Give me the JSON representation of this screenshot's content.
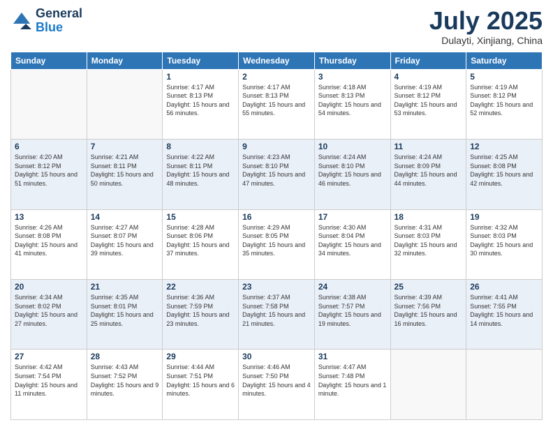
{
  "logo": {
    "general": "General",
    "blue": "Blue"
  },
  "header": {
    "month": "July 2025",
    "location": "Dulayti, Xinjiang, China"
  },
  "weekdays": [
    "Sunday",
    "Monday",
    "Tuesday",
    "Wednesday",
    "Thursday",
    "Friday",
    "Saturday"
  ],
  "weeks": [
    [
      {
        "day": "",
        "info": ""
      },
      {
        "day": "",
        "info": ""
      },
      {
        "day": "1",
        "info": "Sunrise: 4:17 AM\nSunset: 8:13 PM\nDaylight: 15 hours and 56 minutes."
      },
      {
        "day": "2",
        "info": "Sunrise: 4:17 AM\nSunset: 8:13 PM\nDaylight: 15 hours and 55 minutes."
      },
      {
        "day": "3",
        "info": "Sunrise: 4:18 AM\nSunset: 8:13 PM\nDaylight: 15 hours and 54 minutes."
      },
      {
        "day": "4",
        "info": "Sunrise: 4:19 AM\nSunset: 8:12 PM\nDaylight: 15 hours and 53 minutes."
      },
      {
        "day": "5",
        "info": "Sunrise: 4:19 AM\nSunset: 8:12 PM\nDaylight: 15 hours and 52 minutes."
      }
    ],
    [
      {
        "day": "6",
        "info": "Sunrise: 4:20 AM\nSunset: 8:12 PM\nDaylight: 15 hours and 51 minutes."
      },
      {
        "day": "7",
        "info": "Sunrise: 4:21 AM\nSunset: 8:11 PM\nDaylight: 15 hours and 50 minutes."
      },
      {
        "day": "8",
        "info": "Sunrise: 4:22 AM\nSunset: 8:11 PM\nDaylight: 15 hours and 48 minutes."
      },
      {
        "day": "9",
        "info": "Sunrise: 4:23 AM\nSunset: 8:10 PM\nDaylight: 15 hours and 47 minutes."
      },
      {
        "day": "10",
        "info": "Sunrise: 4:24 AM\nSunset: 8:10 PM\nDaylight: 15 hours and 46 minutes."
      },
      {
        "day": "11",
        "info": "Sunrise: 4:24 AM\nSunset: 8:09 PM\nDaylight: 15 hours and 44 minutes."
      },
      {
        "day": "12",
        "info": "Sunrise: 4:25 AM\nSunset: 8:08 PM\nDaylight: 15 hours and 42 minutes."
      }
    ],
    [
      {
        "day": "13",
        "info": "Sunrise: 4:26 AM\nSunset: 8:08 PM\nDaylight: 15 hours and 41 minutes."
      },
      {
        "day": "14",
        "info": "Sunrise: 4:27 AM\nSunset: 8:07 PM\nDaylight: 15 hours and 39 minutes."
      },
      {
        "day": "15",
        "info": "Sunrise: 4:28 AM\nSunset: 8:06 PM\nDaylight: 15 hours and 37 minutes."
      },
      {
        "day": "16",
        "info": "Sunrise: 4:29 AM\nSunset: 8:05 PM\nDaylight: 15 hours and 35 minutes."
      },
      {
        "day": "17",
        "info": "Sunrise: 4:30 AM\nSunset: 8:04 PM\nDaylight: 15 hours and 34 minutes."
      },
      {
        "day": "18",
        "info": "Sunrise: 4:31 AM\nSunset: 8:03 PM\nDaylight: 15 hours and 32 minutes."
      },
      {
        "day": "19",
        "info": "Sunrise: 4:32 AM\nSunset: 8:03 PM\nDaylight: 15 hours and 30 minutes."
      }
    ],
    [
      {
        "day": "20",
        "info": "Sunrise: 4:34 AM\nSunset: 8:02 PM\nDaylight: 15 hours and 27 minutes."
      },
      {
        "day": "21",
        "info": "Sunrise: 4:35 AM\nSunset: 8:01 PM\nDaylight: 15 hours and 25 minutes."
      },
      {
        "day": "22",
        "info": "Sunrise: 4:36 AM\nSunset: 7:59 PM\nDaylight: 15 hours and 23 minutes."
      },
      {
        "day": "23",
        "info": "Sunrise: 4:37 AM\nSunset: 7:58 PM\nDaylight: 15 hours and 21 minutes."
      },
      {
        "day": "24",
        "info": "Sunrise: 4:38 AM\nSunset: 7:57 PM\nDaylight: 15 hours and 19 minutes."
      },
      {
        "day": "25",
        "info": "Sunrise: 4:39 AM\nSunset: 7:56 PM\nDaylight: 15 hours and 16 minutes."
      },
      {
        "day": "26",
        "info": "Sunrise: 4:41 AM\nSunset: 7:55 PM\nDaylight: 15 hours and 14 minutes."
      }
    ],
    [
      {
        "day": "27",
        "info": "Sunrise: 4:42 AM\nSunset: 7:54 PM\nDaylight: 15 hours and 11 minutes."
      },
      {
        "day": "28",
        "info": "Sunrise: 4:43 AM\nSunset: 7:52 PM\nDaylight: 15 hours and 9 minutes."
      },
      {
        "day": "29",
        "info": "Sunrise: 4:44 AM\nSunset: 7:51 PM\nDaylight: 15 hours and 6 minutes."
      },
      {
        "day": "30",
        "info": "Sunrise: 4:46 AM\nSunset: 7:50 PM\nDaylight: 15 hours and 4 minutes."
      },
      {
        "day": "31",
        "info": "Sunrise: 4:47 AM\nSunset: 7:48 PM\nDaylight: 15 hours and 1 minute."
      },
      {
        "day": "",
        "info": ""
      },
      {
        "day": "",
        "info": ""
      }
    ]
  ]
}
